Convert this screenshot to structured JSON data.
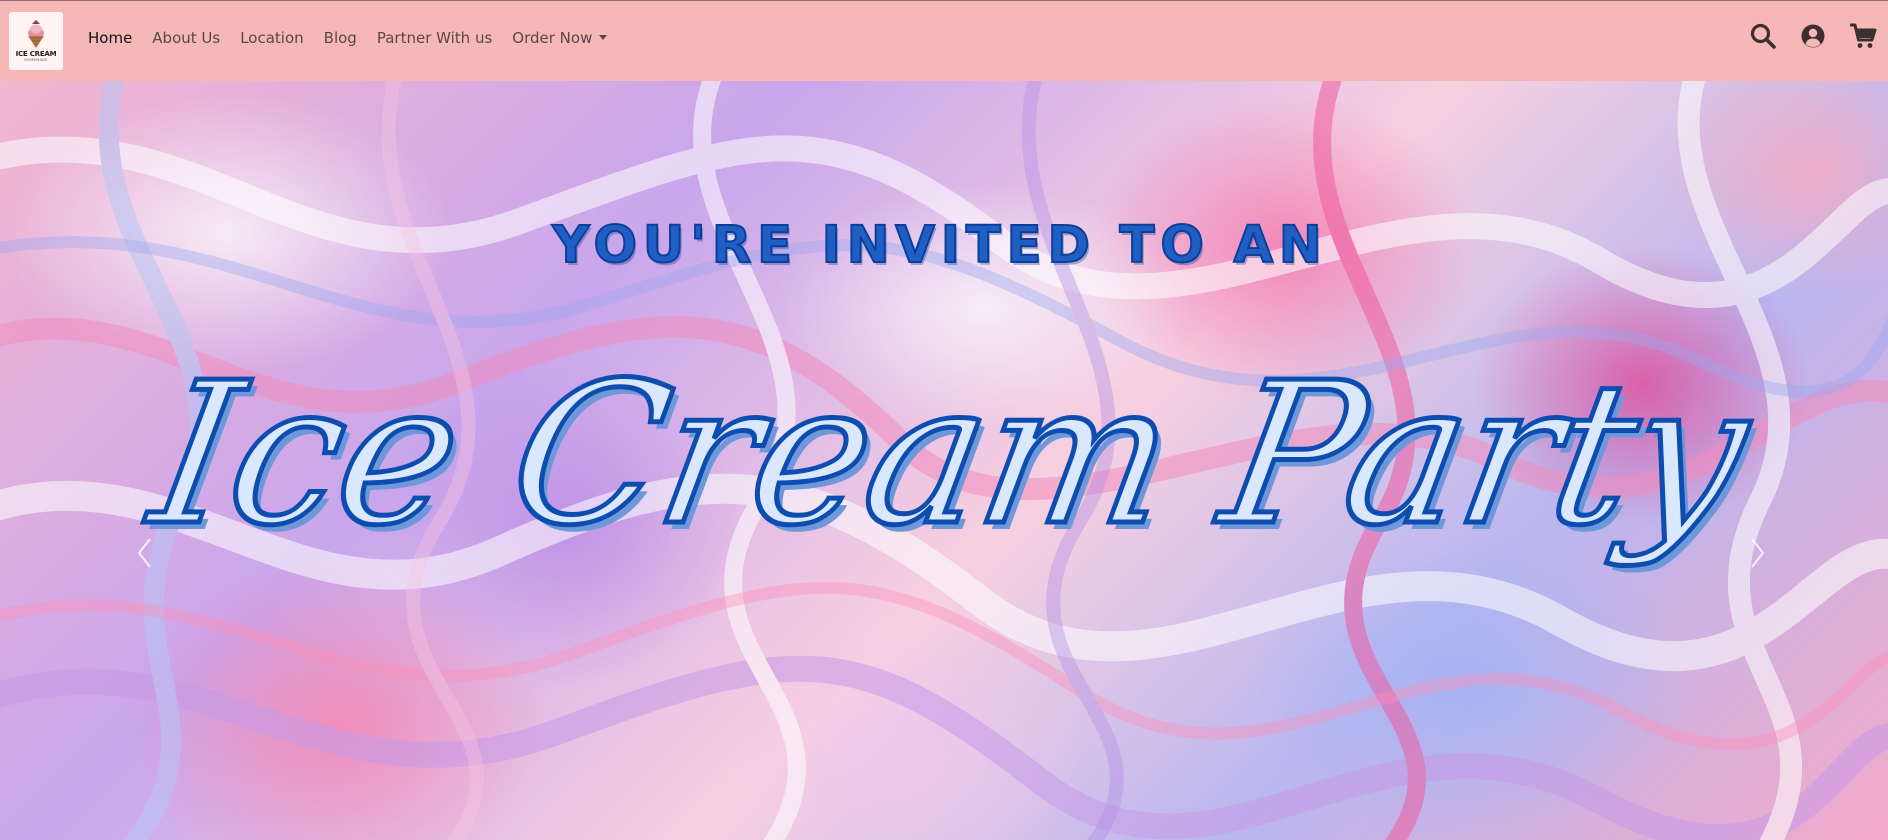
{
  "brand": {
    "logo_text": "ICE CREAM",
    "logo_subtext": "HOMEMADE"
  },
  "nav": {
    "links": [
      {
        "label": "Home",
        "active": true
      },
      {
        "label": "About Us",
        "active": false
      },
      {
        "label": "Location",
        "active": false
      },
      {
        "label": "Blog",
        "active": false
      },
      {
        "label": "Partner With us",
        "active": false
      },
      {
        "label": "Order Now",
        "active": false,
        "dropdown": true
      }
    ],
    "icons": [
      "search-icon",
      "account-icon",
      "cart-icon"
    ]
  },
  "hero": {
    "kicker": "YOU'RE INVITED TO AN",
    "title": "Ice Cream Party",
    "prev_icon": "chevron-left-icon",
    "next_icon": "chevron-right-icon"
  },
  "colors": {
    "navbar_bg": "#f6b8b7",
    "hero_text": "#1f5fc4",
    "hero_outline": "#0d4db0",
    "nav_text": "#5a4646",
    "nav_active": "#111111"
  }
}
